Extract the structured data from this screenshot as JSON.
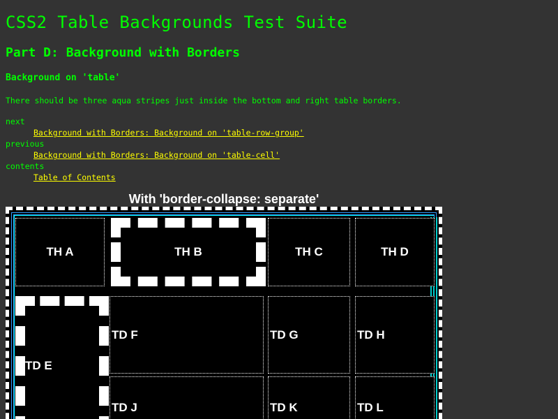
{
  "title": "CSS2 Table Backgrounds Test Suite",
  "part": "Part D: Background with Borders",
  "section": "Background on 'table'",
  "description": "There should be three aqua stripes just inside the bottom and right table borders.",
  "nav": {
    "next_label": "next",
    "next_link": "Background with Borders: Background on 'table-row-group'",
    "previous_label": "previous",
    "previous_link": "Background with Borders: Background on 'table-cell'",
    "contents_label": "contents",
    "contents_link": "Table of Contents"
  },
  "table": {
    "caption": "With 'border-collapse: separate'",
    "header_cells": [
      "TH A",
      "TH B",
      "TH C",
      "TH D"
    ],
    "row1_cells": [
      "TD E",
      "TD F",
      "TD G",
      "TD H"
    ],
    "row2_cells": [
      "TD J",
      "TD K",
      "TD L"
    ]
  },
  "colors": {
    "background": "#333333",
    "text": "#00ff00",
    "link": "#ffff00",
    "stripe": "#00cccc"
  }
}
